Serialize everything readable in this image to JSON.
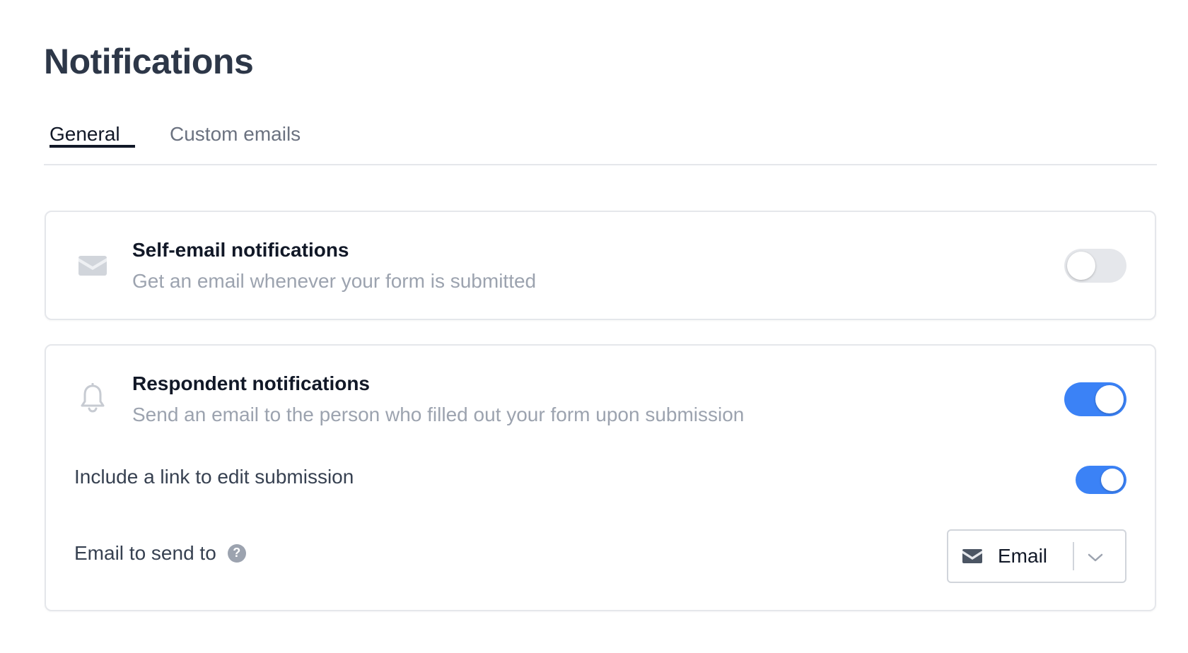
{
  "page": {
    "title": "Notifications"
  },
  "tabs": [
    {
      "label": "General",
      "active": true
    },
    {
      "label": "Custom emails",
      "active": false
    }
  ],
  "self_email": {
    "icon": "envelope-icon",
    "title": "Self-email notifications",
    "description": "Get an email whenever your form is submitted",
    "enabled": false
  },
  "respondent": {
    "icon": "bell-icon",
    "title": "Respondent notifications",
    "description": "Send an email to the person who filled out your form upon submission",
    "enabled": true,
    "edit_link": {
      "label": "Include a link to edit submission",
      "enabled": true
    },
    "email_to": {
      "label": "Email to send to",
      "help_icon": "question-circle-icon",
      "help_glyph": "?",
      "select_icon": "envelope-icon",
      "selected": "Email"
    }
  },
  "colors": {
    "accent": "#3b82f6",
    "toggle_off": "#e5e7eb",
    "heading": "#2d3748",
    "muted_text": "#9ca3af"
  }
}
